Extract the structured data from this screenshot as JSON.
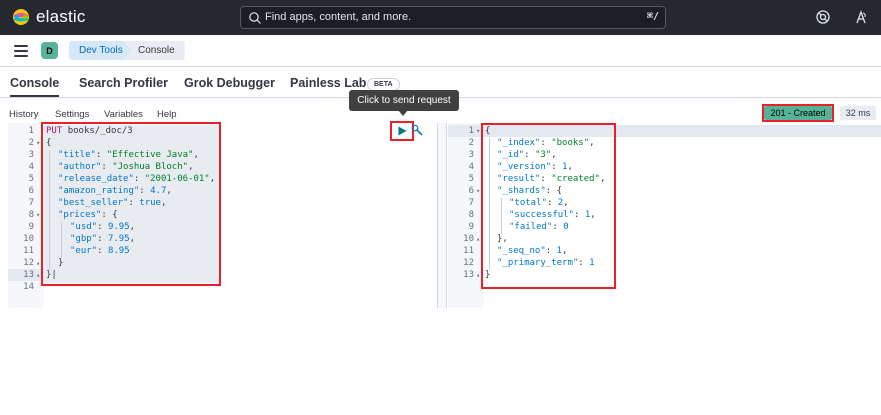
{
  "header": {
    "brand": "elastic",
    "search_placeholder": "Find apps, content, and more.",
    "search_shortcut": "⌘/"
  },
  "breadcrumbs": {
    "space_initial": "D",
    "items": [
      "Dev Tools",
      "Console"
    ]
  },
  "tabs": {
    "items": [
      "Console",
      "Search Profiler",
      "Grok Debugger",
      "Painless Lab"
    ],
    "active": "Console",
    "beta_badge": "BETA"
  },
  "console_menu": {
    "items": [
      "History",
      "Settings",
      "Variables",
      "Help"
    ]
  },
  "tooltip": "Click to send request",
  "response_status": {
    "status": "201 - Created",
    "timing": "32 ms",
    "status_color": "#54b399"
  },
  "request_editor": {
    "line_numbers": [
      "1",
      "2",
      "3",
      "4",
      "5",
      "6",
      "7",
      "8",
      "9",
      "10",
      "11",
      "12",
      "13",
      "14"
    ],
    "method": "PUT",
    "url": "books/_doc/3",
    "lines": [
      {
        "key": "\"title\"",
        "value": "\"Effective Java\"",
        "type": "str",
        "trail": ","
      },
      {
        "key": "\"author\"",
        "value": "\"Joshua Bloch\"",
        "type": "str",
        "trail": ","
      },
      {
        "key": "\"release_date\"",
        "value": "\"2001-06-01\"",
        "type": "str",
        "trail": ","
      },
      {
        "key": "\"amazon_rating\"",
        "value": "4.7",
        "type": "num",
        "trail": ","
      },
      {
        "key": "\"best_seller\"",
        "value": "true",
        "type": "bool",
        "trail": ","
      },
      {
        "key": "\"prices\"",
        "value": "{",
        "type": "punc",
        "trail": ""
      },
      {
        "key": "\"usd\"",
        "value": "9.95",
        "type": "num",
        "trail": ","
      },
      {
        "key": "\"gbp\"",
        "value": "7.95",
        "type": "num",
        "trail": ","
      },
      {
        "key": "\"eur\"",
        "value": "8.95",
        "type": "num",
        "trail": ""
      }
    ]
  },
  "response_editor": {
    "line_numbers": [
      "1",
      "2",
      "3",
      "4",
      "5",
      "6",
      "7",
      "8",
      "9",
      "10",
      "11",
      "12",
      "13"
    ],
    "lines": [
      {
        "key": "\"_index\"",
        "value": "\"books\"",
        "type": "str",
        "trail": ","
      },
      {
        "key": "\"_id\"",
        "value": "\"3\"",
        "type": "str",
        "trail": ","
      },
      {
        "key": "\"_version\"",
        "value": "1",
        "type": "num",
        "trail": ","
      },
      {
        "key": "\"result\"",
        "value": "\"created\"",
        "type": "str",
        "trail": ","
      },
      {
        "key": "\"_shards\"",
        "value": "{",
        "type": "punc",
        "trail": ""
      },
      {
        "key": "\"total\"",
        "value": "2",
        "type": "num",
        "trail": ","
      },
      {
        "key": "\"successful\"",
        "value": "1",
        "type": "num",
        "trail": ","
      },
      {
        "key": "\"failed\"",
        "value": "0",
        "type": "num",
        "trail": ""
      },
      {
        "key": "\"_seq_no\"",
        "value": "1",
        "type": "num",
        "trail": ","
      },
      {
        "key": "\"_primary_term\"",
        "value": "1",
        "type": "num",
        "trail": ""
      }
    ]
  },
  "colors": {
    "header_bg": "#25282f",
    "highlight_box": "#e8202a",
    "play_button": "#017d73"
  }
}
